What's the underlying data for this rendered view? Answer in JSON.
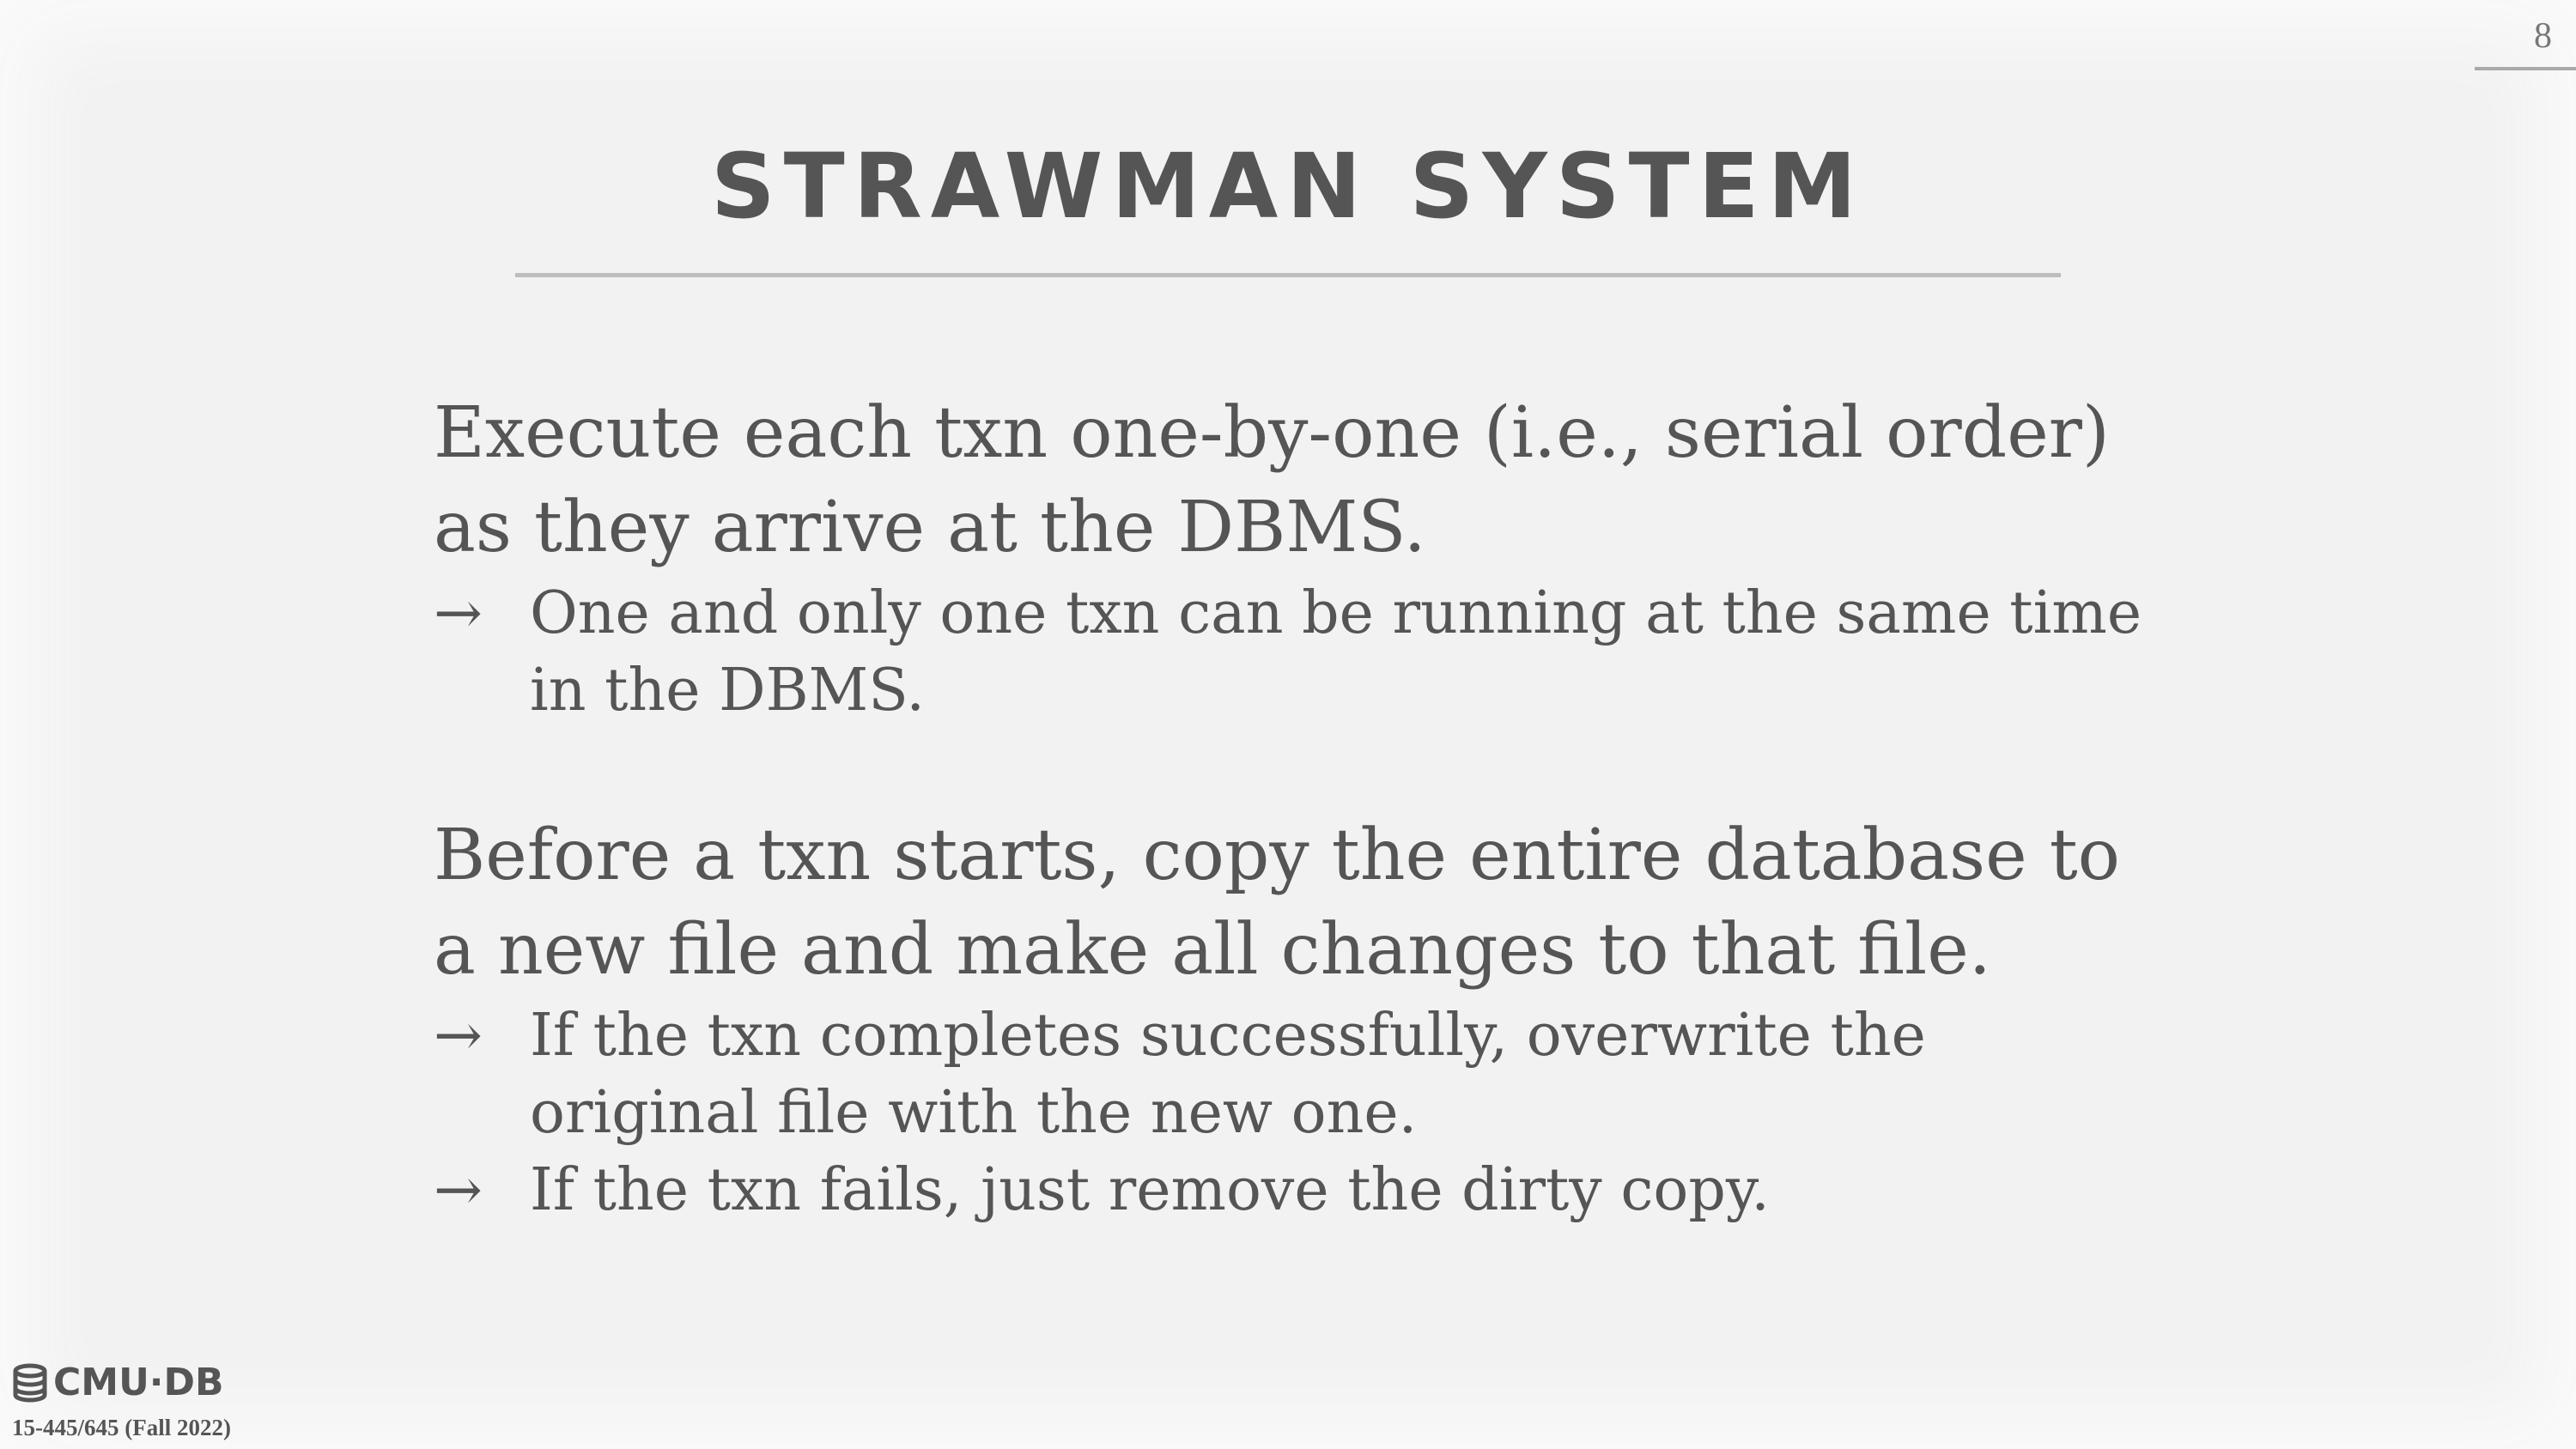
{
  "slide": {
    "page_number": "8",
    "title": "STRAWMAN SYSTEM",
    "points": [
      {
        "text": "Execute each txn one-by-one (i.e., serial order) as they arrive at the DBMS.",
        "bullets": [
          "One and only one txn can be running at the same time in the DBMS."
        ]
      },
      {
        "text": "Before a txn starts, copy the entire database to a new file and make all changes to that file.",
        "bullets": [
          "If the txn completes successfully, overwrite the original file with the new one.",
          "If the txn fails, just remove the dirty copy."
        ]
      }
    ],
    "arrow_glyph": "→"
  },
  "footer": {
    "logo_text": "CMU·DB",
    "logo_icon": "database-icon",
    "course": "15-445/645 (Fall 2022)"
  }
}
